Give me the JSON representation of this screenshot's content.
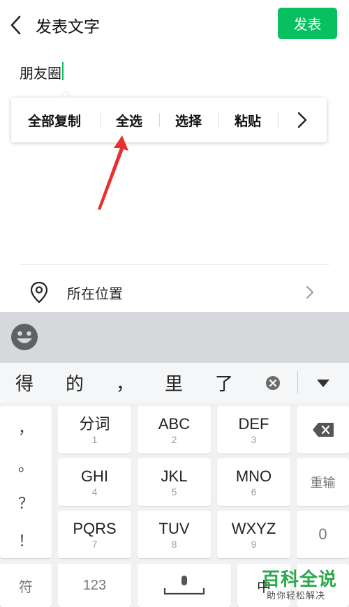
{
  "header": {
    "title": "发表文字",
    "publish_label": "发表"
  },
  "compose": {
    "text": "朋友圈"
  },
  "context_menu": {
    "items": [
      "全部复制",
      "全选",
      "选择",
      "粘贴"
    ]
  },
  "location": {
    "label": "所在位置"
  },
  "keyboard": {
    "candidates": [
      "得",
      "的",
      "，",
      "里",
      "了"
    ],
    "punctuation": [
      "，",
      "。",
      "？",
      "！"
    ],
    "keys": [
      {
        "main": "分词",
        "num": "1"
      },
      {
        "main": "ABC",
        "num": "2"
      },
      {
        "main": "DEF",
        "num": "3"
      },
      {
        "main": "GHI",
        "num": "4"
      },
      {
        "main": "JKL",
        "num": "5"
      },
      {
        "main": "MNO",
        "num": "6"
      },
      {
        "main": "PQRS",
        "num": "7"
      },
      {
        "main": "TUV",
        "num": "8"
      },
      {
        "main": "WXYZ",
        "num": "9"
      }
    ],
    "reinput_label": "重输",
    "zero_label": "0",
    "symbol_label": "符",
    "numeric_label": "123",
    "lang_label": "中"
  },
  "watermark": {
    "title": "百科全说",
    "subtitle": "助你轻松解决"
  },
  "colors": {
    "accent": "#07c160",
    "arrow": "#e8302c",
    "watermark": "#2aa84a"
  }
}
